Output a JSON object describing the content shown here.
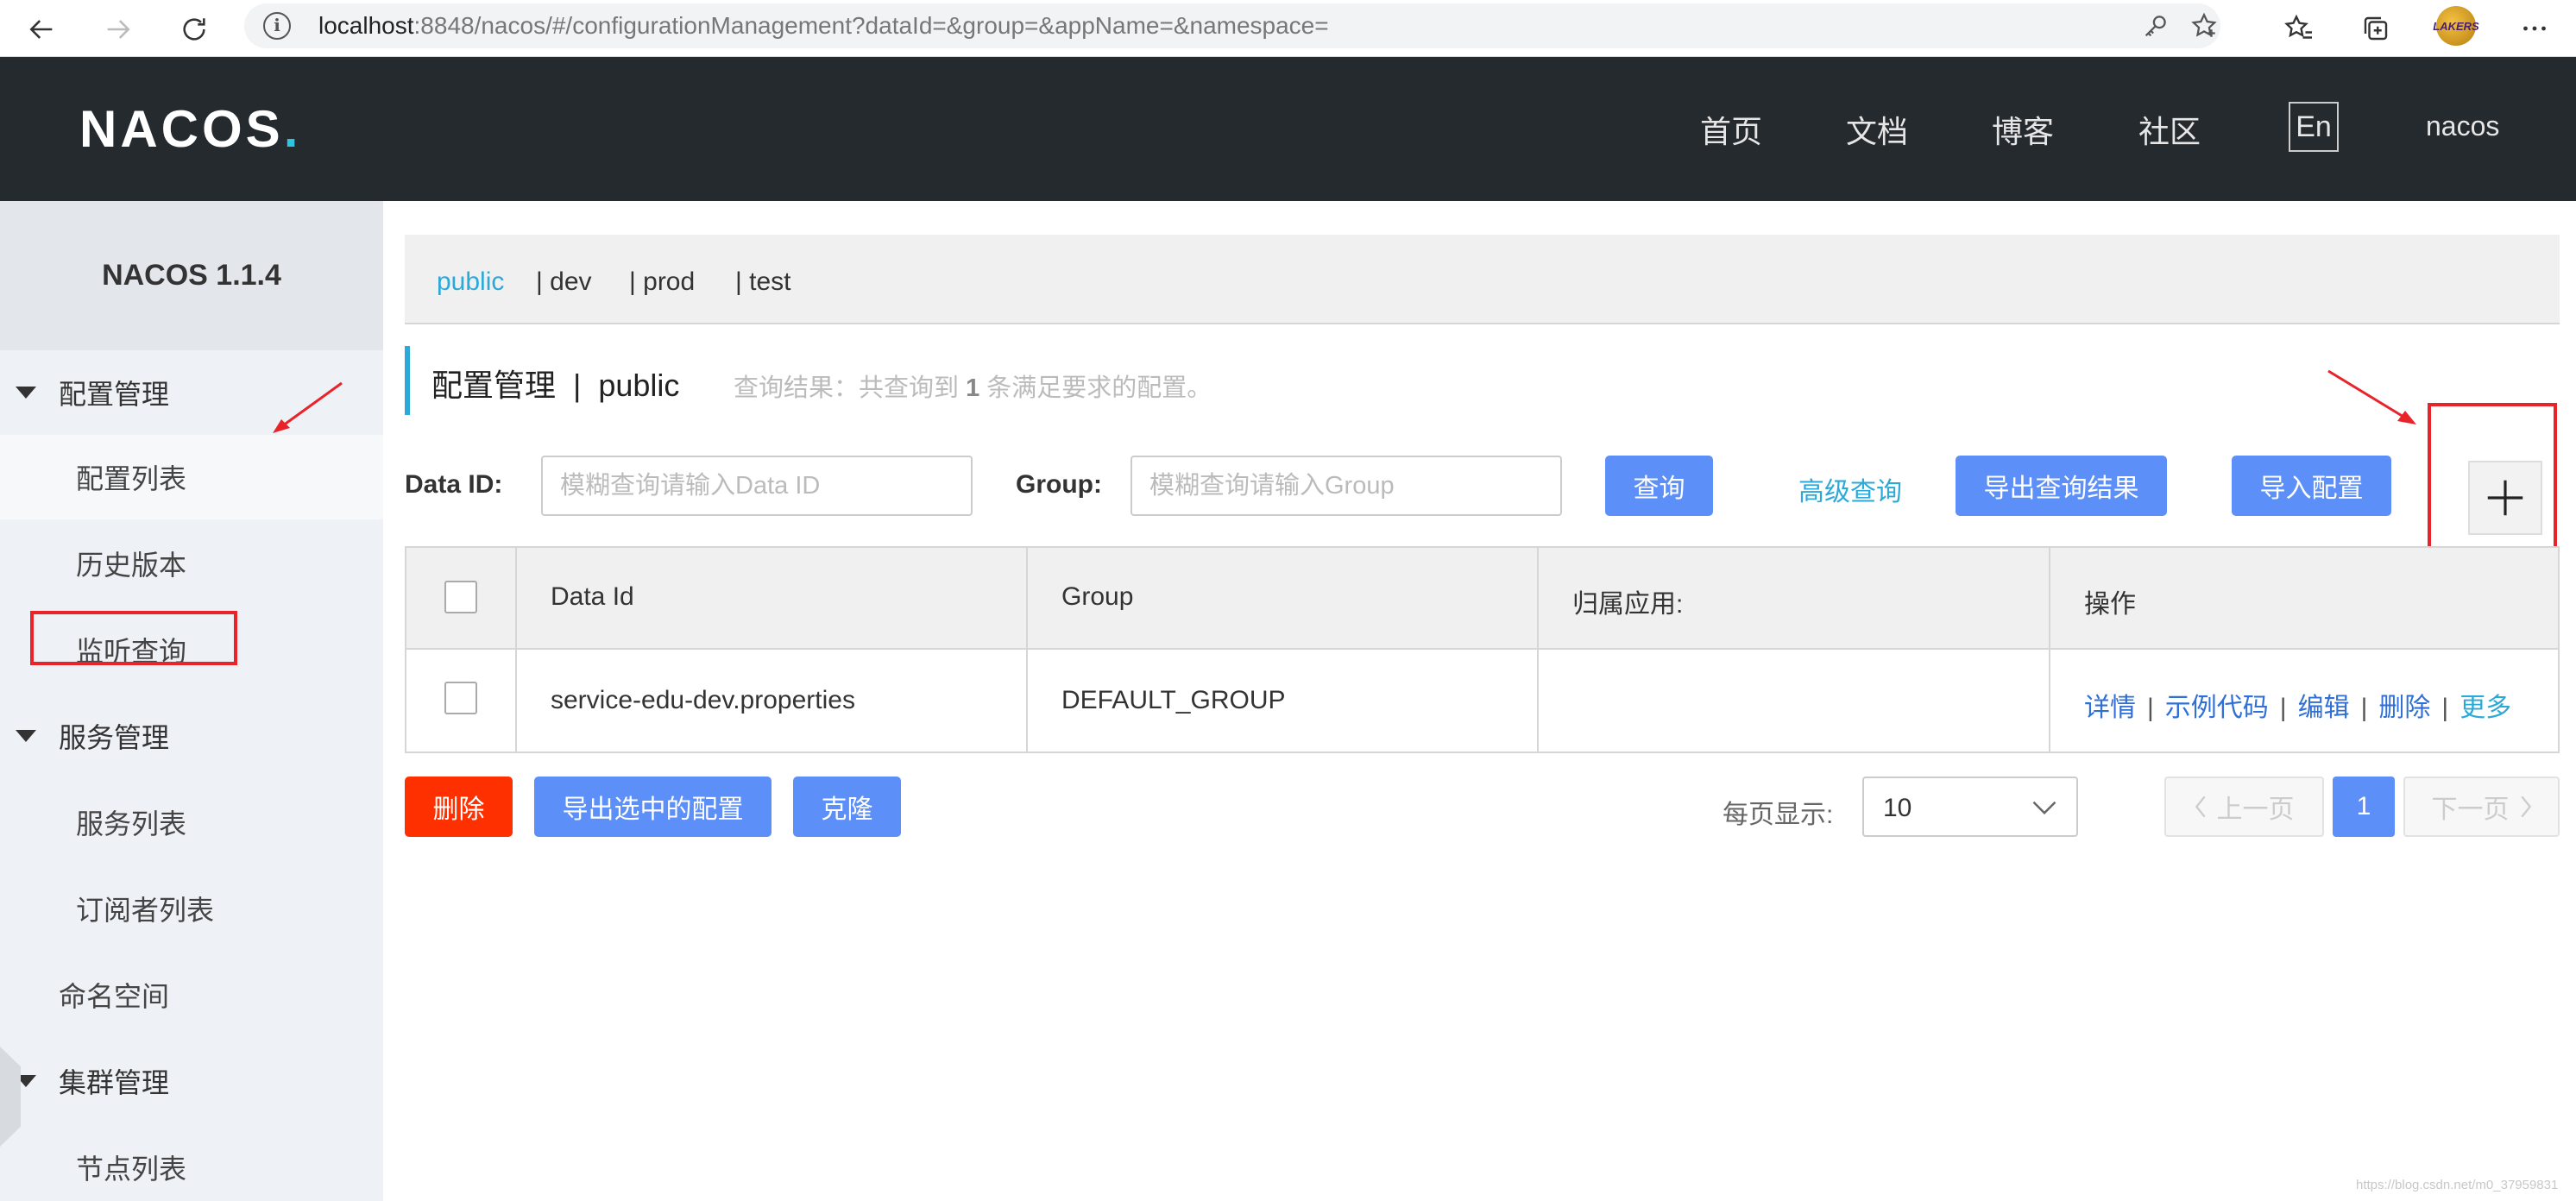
{
  "browser": {
    "url_host": "localhost",
    "url_path": ":8848/nacos/#/configurationManagement?dataId=&group=&appName=&namespace=",
    "avatar_text": "LAKERS",
    "icons": [
      "back-icon",
      "forward-icon",
      "refresh-icon",
      "info-icon",
      "key-icon",
      "add-favorite-icon",
      "favorites-icon",
      "collections-icon",
      "avatar",
      "more-icon"
    ]
  },
  "header": {
    "logo_main": "NACOS",
    "logo_dot": ".",
    "nav": [
      "首页",
      "文档",
      "博客",
      "社区"
    ],
    "lang": "En",
    "user": "nacos"
  },
  "sidebar": {
    "title": "NACOS 1.1.4",
    "groups": [
      {
        "label": "配置管理",
        "items": [
          "配置列表",
          "历史版本",
          "监听查询"
        ]
      },
      {
        "label": "服务管理",
        "items": [
          "服务列表",
          "订阅者列表"
        ]
      },
      {
        "label": "命名空间",
        "items": []
      },
      {
        "label": "集群管理",
        "items": [
          "节点列表"
        ]
      }
    ],
    "active_item": "配置列表"
  },
  "namespaces": [
    "public",
    "| dev",
    "| prod",
    "| test"
  ],
  "active_namespace": "public",
  "page": {
    "title": "配置管理  |  public",
    "summary_prefix": "查询结果：共查询到",
    "summary_count": "1",
    "summary_suffix": "条满足要求的配置。"
  },
  "search": {
    "data_id_label": "Data ID:",
    "data_id_placeholder": "模糊查询请输入Data ID",
    "group_label": "Group:",
    "group_placeholder": "模糊查询请输入Group",
    "query_button": "查询",
    "advanced_query": "高级查询",
    "export_results_button": "导出查询结果",
    "import_button": "导入配置",
    "add_button_icon": "plus-icon"
  },
  "table": {
    "columns": [
      "Data Id",
      "Group",
      "归属应用:",
      "操作"
    ],
    "rows": [
      {
        "data_id": "service-edu-dev.properties",
        "group": "DEFAULT_GROUP",
        "app": "",
        "ops": [
          "详情",
          "示例代码",
          "编辑",
          "删除",
          "更多"
        ]
      }
    ]
  },
  "bulk_actions": {
    "delete": "删除",
    "export_selected": "导出选中的配置",
    "clone": "克隆"
  },
  "pagination": {
    "page_size_label": "每页显示:",
    "page_size": "10",
    "prev": "上一页",
    "current": "1",
    "next": "下一页"
  },
  "watermark": "https://blog.csdn.net/m0_37959831",
  "colors": {
    "header_bg": "#252a2f",
    "accent": "#2ba9d8",
    "primary_button": "#5c8ff7",
    "danger_button": "#ff3000",
    "annotation_red": "#e8232a"
  }
}
